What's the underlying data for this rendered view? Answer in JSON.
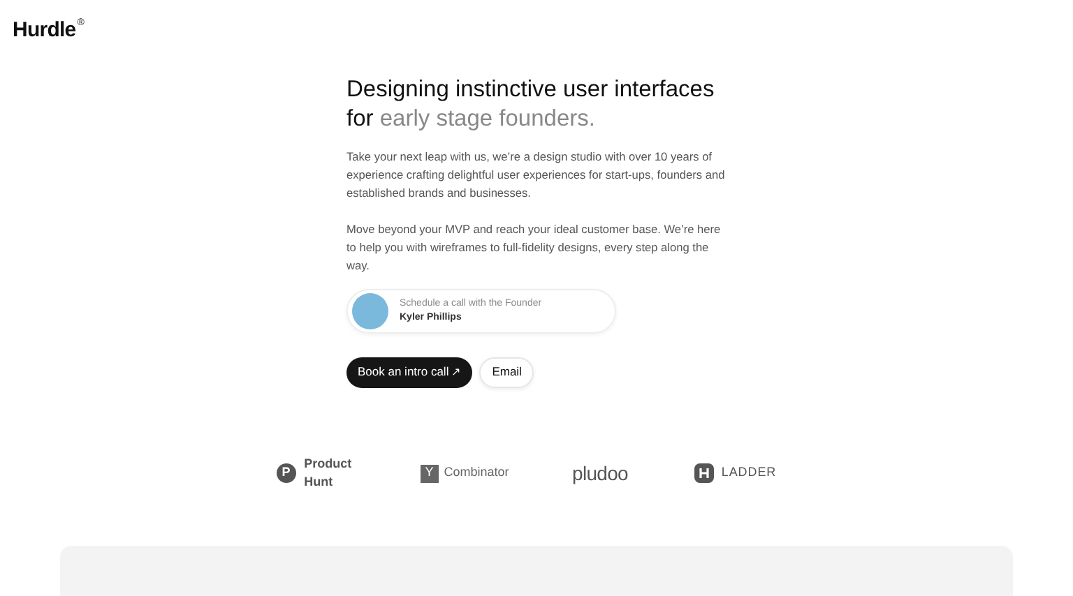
{
  "brand": {
    "name": "Hurdle",
    "mark": "®"
  },
  "hero": {
    "title_line_1": "Designing instinctive user interfaces",
    "title_lead": "for",
    "title_muted": "early stage founders.",
    "paragraphs": [
      "Take your next leap with us, we’re a design studio with over 10 years of experience crafting delightful user experiences for start-ups, founders and established brands and businesses.",
      "Move beyond your MVP and reach your ideal customer base. We’re here to help you with wireframes to full-fidelity designs, every step along the way."
    ]
  },
  "founder_card": {
    "caption": "Schedule a call with the Founder",
    "name": "Kyler Phillips"
  },
  "buttons": [
    {
      "kind": "primary",
      "label": "Book an intro call",
      "arrow": "↗"
    },
    {
      "kind": "secondary",
      "label": "Email"
    }
  ],
  "logos": [
    {
      "kind": "producthunt",
      "badge": "P",
      "label": "Product Hunt"
    },
    {
      "kind": "ycombinator",
      "badge": "Y",
      "label": "Combinator"
    },
    {
      "kind": "wordmark",
      "label": "pludoo"
    },
    {
      "kind": "ladder",
      "label": "LADDER"
    }
  ]
}
